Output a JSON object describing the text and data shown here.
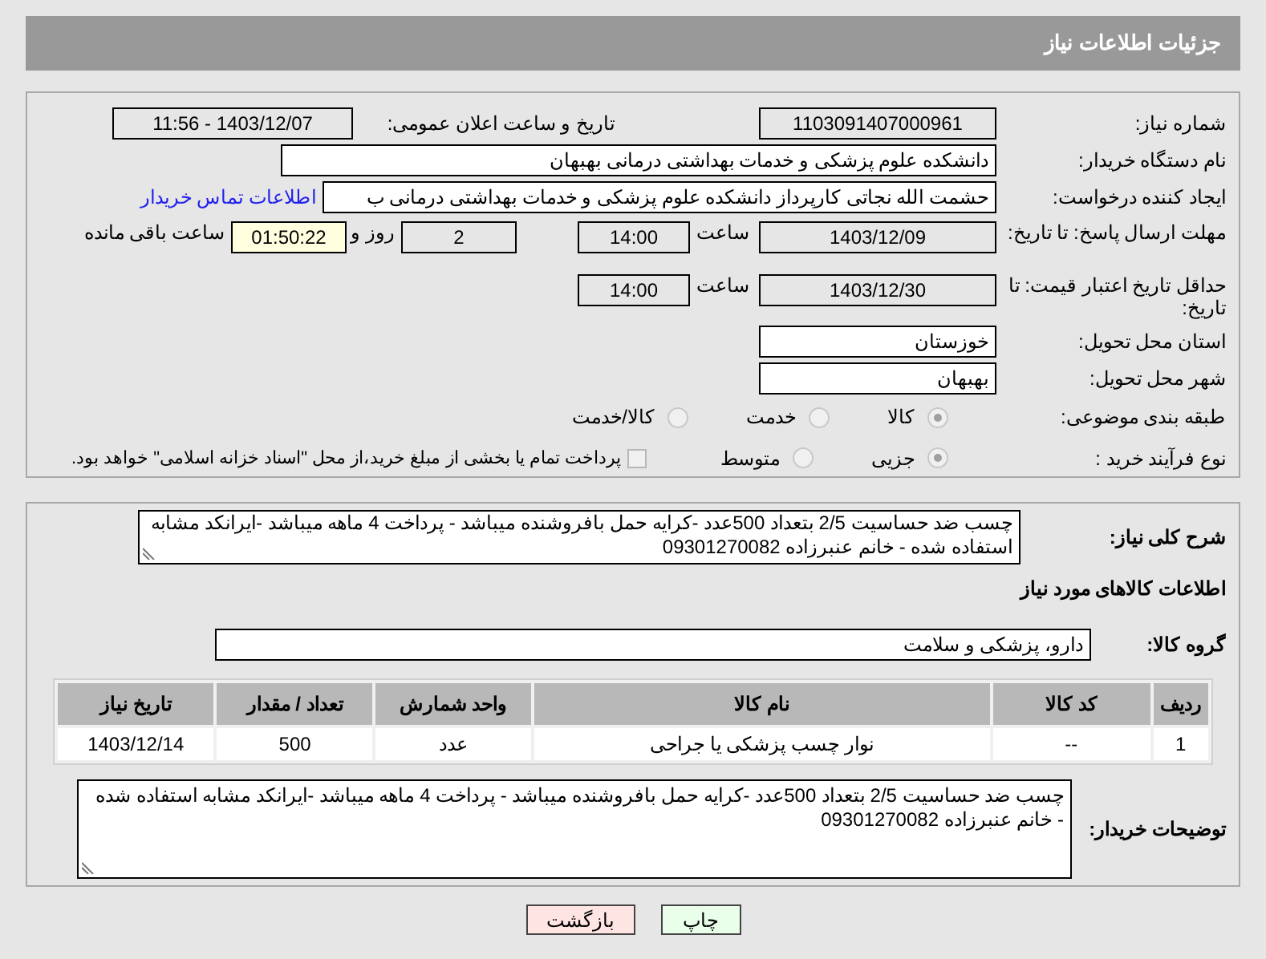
{
  "header": {
    "title": "جزئیات اطلاعات نیاز"
  },
  "need_number": {
    "label": "شماره نیاز:",
    "value": "1103091407000961"
  },
  "announce": {
    "label": "تاریخ و ساعت اعلان عمومی:",
    "value": "1403/12/07 - 11:56"
  },
  "buyer_org": {
    "label": "نام دستگاه خریدار:",
    "value": "دانشکده علوم پزشکی و خدمات بهداشتی  درمانی بهبهان"
  },
  "requester": {
    "label": "ایجاد کننده درخواست:",
    "value": "حشمت الله نجاتی کارپرداز دانشکده علوم پزشکی و خدمات بهداشتی  درمانی ب",
    "link": "اطلاعات تماس خریدار"
  },
  "reply_deadline": {
    "label": "مهلت ارسال پاسخ: تا تاریخ:",
    "date": "1403/12/09",
    "time_label": "ساعت",
    "time": "14:00",
    "days": "2",
    "days_label": "روز و",
    "remaining": "01:50:22",
    "remaining_label": "ساعت باقی مانده"
  },
  "price_validity": {
    "label": "حداقل تاریخ اعتبار قیمت: تا تاریخ:",
    "date": "1403/12/30",
    "time_label": "ساعت",
    "time": "14:00"
  },
  "province": {
    "label": "استان محل تحویل:",
    "value": "خوزستان"
  },
  "city": {
    "label": "شهر محل تحویل:",
    "value": "بهبهان"
  },
  "category": {
    "label": "طبقه بندی موضوعی:",
    "options": [
      {
        "label": "کالا",
        "selected": true
      },
      {
        "label": "خدمت",
        "selected": false
      },
      {
        "label": "کالا/خدمت",
        "selected": false
      }
    ]
  },
  "process": {
    "label": "نوع فرآیند خرید :",
    "options": [
      {
        "label": "جزیی",
        "selected": true
      },
      {
        "label": "متوسط",
        "selected": false
      }
    ],
    "payment": {
      "label": "پرداخت تمام یا بخشی از مبلغ خرید،از محل \"اسناد خزانه اسلامی\" خواهد بود.",
      "checked": false
    }
  },
  "description": {
    "label": "شرح کلی نیاز:",
    "value": "چسب ضد حساسیت 2/5 بتعداد 500عدد -کرایه حمل بافروشنده میباشد - پرداخت 4 ماهه میباشد -ایرانکد مشابه استفاده شده - خانم عنبرزاده  09301270082"
  },
  "goods_heading": "اطلاعات کالاهای مورد نیاز",
  "goods_group": {
    "label": "گروه کالا:",
    "value": "دارو، پزشکی و سلامت"
  },
  "table": {
    "columns": [
      "ردیف",
      "کد کالا",
      "نام کالا",
      "واحد شمارش",
      "تعداد / مقدار",
      "تاریخ نیاز"
    ],
    "rows": [
      [
        "1",
        "--",
        "نوار چسب پزشکی یا جراحی",
        "عدد",
        "500",
        "1403/12/14"
      ]
    ]
  },
  "buyer_notes": {
    "label": "توضیحات خریدار:",
    "value": "چسب ضد حساسیت 2/5 بتعداد 500عدد -کرایه حمل بافروشنده میباشد - پرداخت 4 ماهه میباشد -ایرانکد مشابه استفاده شده - خانم عنبرزاده  09301270082"
  },
  "buttons": [
    {
      "label": "چاپ",
      "kind": "print"
    },
    {
      "label": "بازگشت",
      "kind": "back"
    }
  ]
}
